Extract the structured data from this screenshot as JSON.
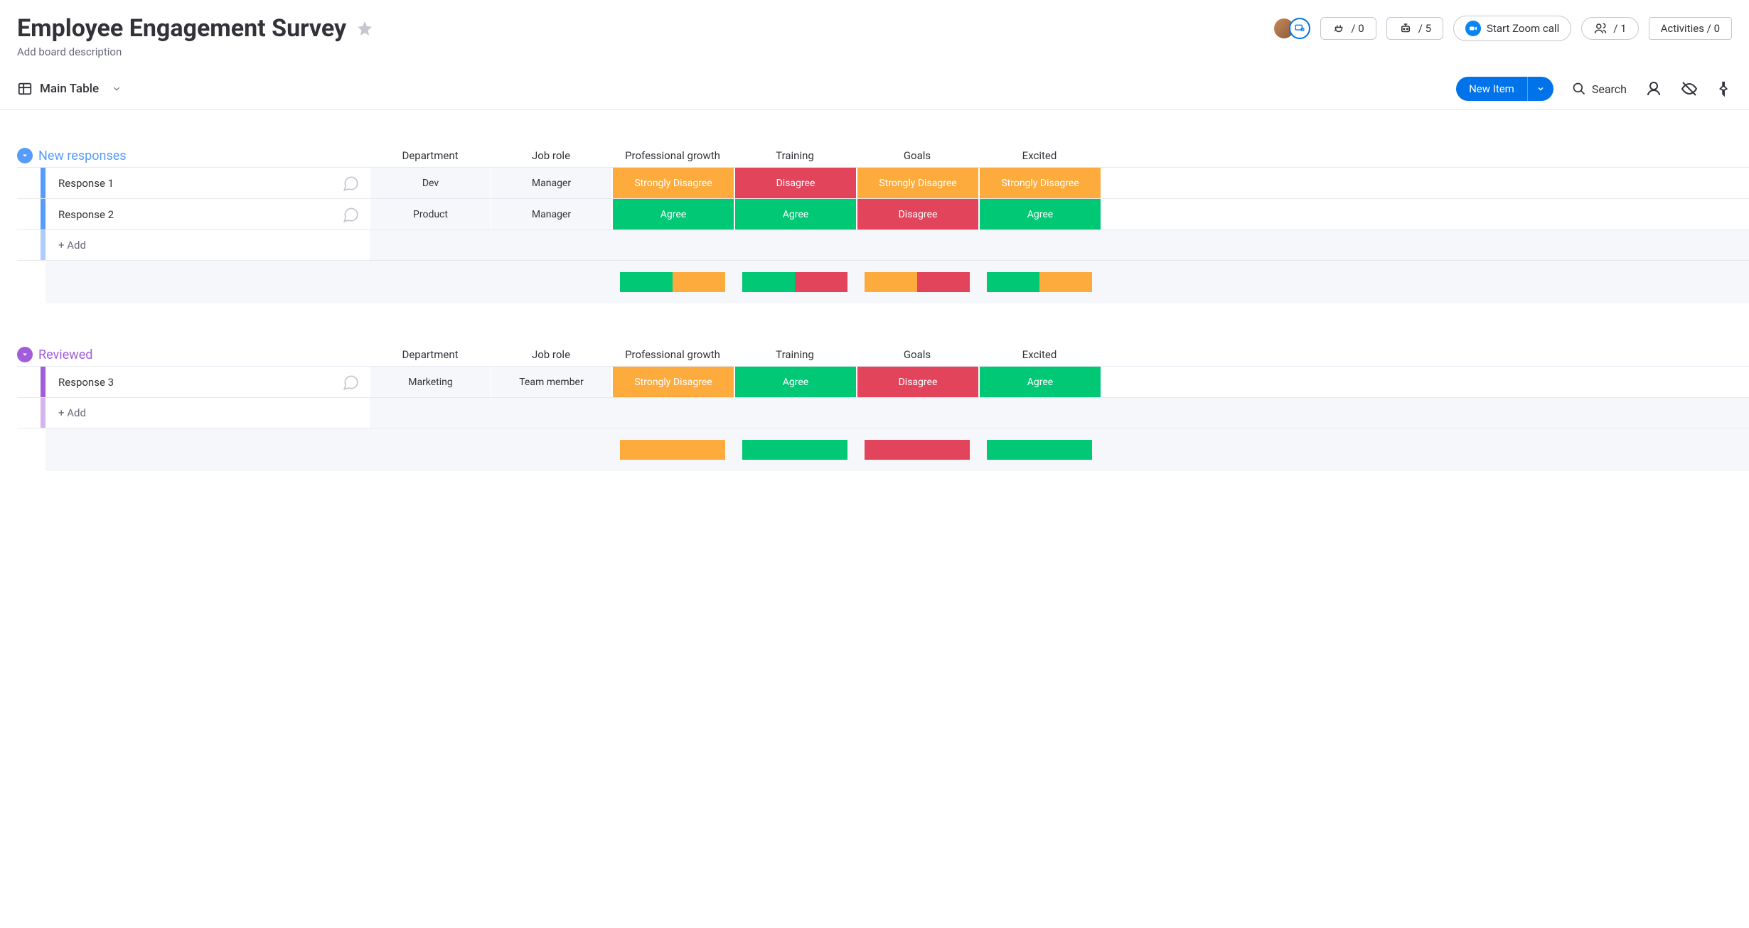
{
  "header": {
    "title": "Employee Engagement Survey",
    "subtitle": "Add board description",
    "plug_count": "/ 0",
    "robot_count": "/ 5",
    "zoom_label": "Start Zoom call",
    "people_count": "/ 1",
    "activities_label": "Activities / 0"
  },
  "toolbar": {
    "view_label": "Main Table",
    "new_item_label": "New Item",
    "search_label": "Search"
  },
  "columns": {
    "dept": "Department",
    "role": "Job role",
    "c0": "Professional growth",
    "c1": "Training",
    "c2": "Goals",
    "c3": "Excited"
  },
  "status_labels": {
    "strong_disagree": "Strongly Disagree",
    "disagree": "Disagree",
    "agree": "Agree"
  },
  "groups": [
    {
      "name": "New responses",
      "color": "#579bfc",
      "collapse_bg": "#579bfc",
      "rows": [
        {
          "name": "Response 1",
          "dept": "Dev",
          "role": "Manager",
          "cells": [
            "strong_disagree",
            "disagree",
            "strong_disagree",
            "strong_disagree"
          ]
        },
        {
          "name": "Response 2",
          "dept": "Product",
          "role": "Manager",
          "cells": [
            "agree",
            "agree",
            "disagree",
            "agree"
          ]
        }
      ],
      "add_label": "+ Add",
      "summary": [
        [
          [
            "green",
            50
          ],
          [
            "orange",
            50
          ]
        ],
        [
          [
            "green",
            50
          ],
          [
            "red",
            50
          ]
        ],
        [
          [
            "orange",
            50
          ],
          [
            "red",
            50
          ]
        ],
        [
          [
            "green",
            50
          ],
          [
            "orange",
            50
          ]
        ]
      ]
    },
    {
      "name": "Reviewed",
      "color": "#a25ddc",
      "collapse_bg": "#a25ddc",
      "rows": [
        {
          "name": "Response 3",
          "dept": "Marketing",
          "role": "Team member",
          "cells": [
            "strong_disagree",
            "agree",
            "disagree",
            "agree"
          ]
        }
      ],
      "add_label": "+ Add",
      "summary": [
        [
          [
            "orange",
            100
          ]
        ],
        [
          [
            "green",
            100
          ]
        ],
        [
          [
            "red",
            100
          ]
        ],
        [
          [
            "green",
            100
          ]
        ]
      ]
    }
  ]
}
